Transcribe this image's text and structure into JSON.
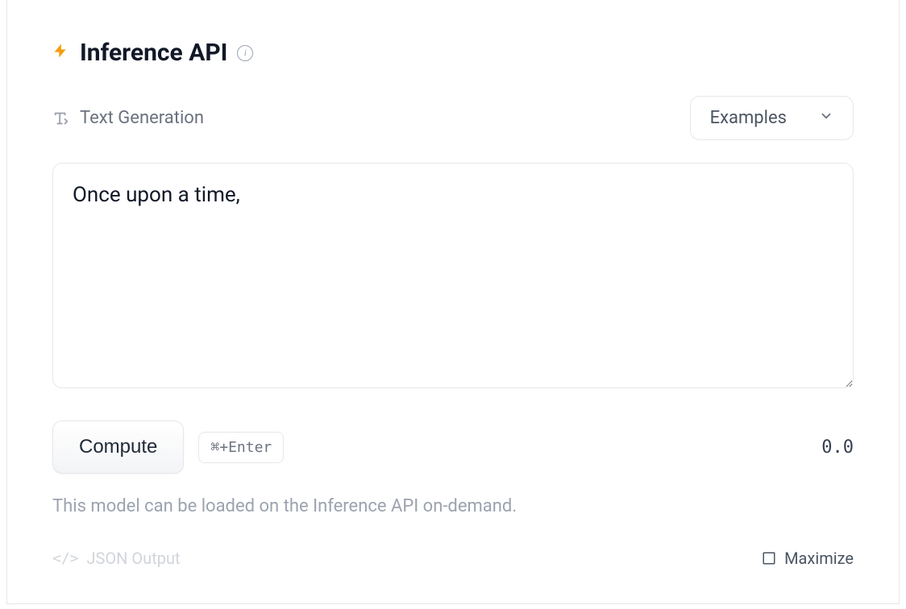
{
  "header": {
    "title": "Inference API"
  },
  "task": {
    "label": "Text Generation"
  },
  "examples": {
    "label": "Examples"
  },
  "input": {
    "value": "Once upon a time,"
  },
  "actions": {
    "compute_label": "Compute",
    "shortcut": "⌘+Enter",
    "score": "0.0"
  },
  "status": {
    "text": "This model can be loaded on the Inference API on-demand."
  },
  "footer": {
    "json_output_label": "JSON Output",
    "maximize_label": "Maximize"
  }
}
